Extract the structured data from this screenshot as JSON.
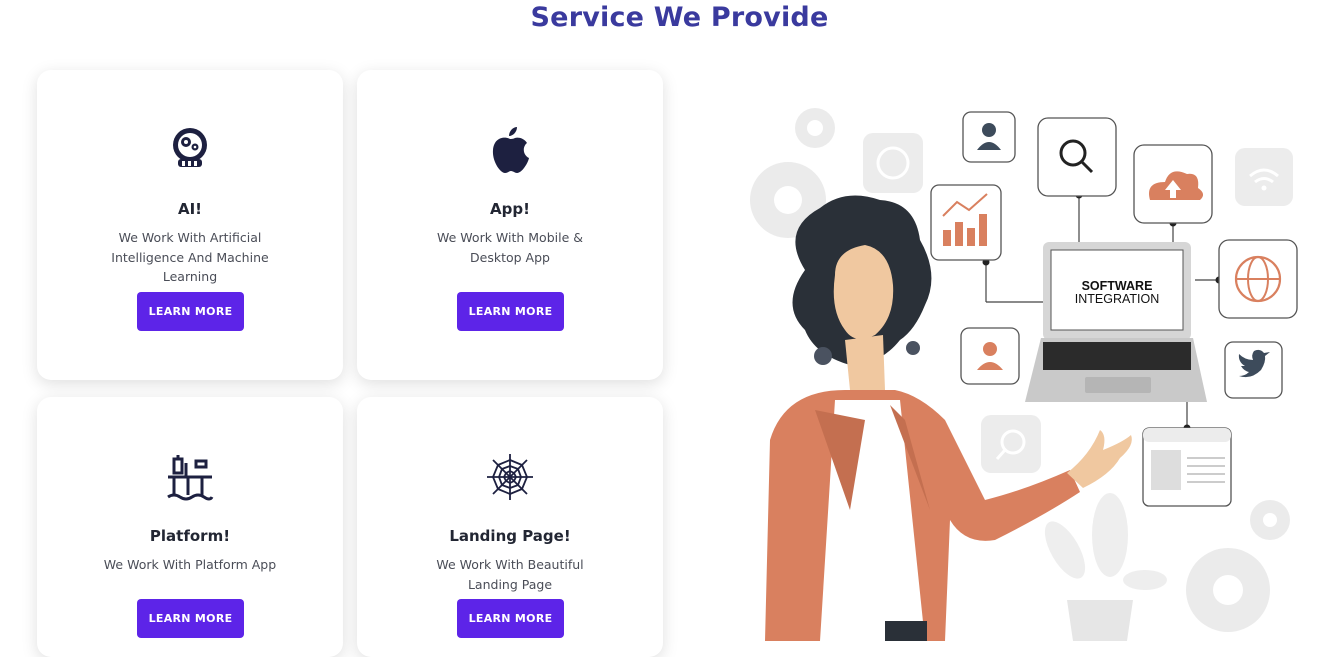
{
  "section": {
    "title": "Service We Provide"
  },
  "cards": [
    {
      "title": "AI!",
      "description": "We Work With Artificial Intelligence And Machine Learning",
      "button": "LEARN MORE",
      "icon": "ai-robot-icon"
    },
    {
      "title": "App!",
      "description": "We Work With Mobile & Desktop App",
      "button": "LEARN MORE",
      "icon": "apple-icon"
    },
    {
      "title": "Platform!",
      "description": "We Work With Platform App",
      "button": "LEARN MORE",
      "icon": "platform-icon"
    },
    {
      "title": "Landing Page!",
      "description": "We Work With Beautiful Landing Page",
      "button": "LEARN MORE",
      "icon": "spider-web-icon"
    }
  ],
  "illustration": {
    "laptop_text_line1": "SOFTWARE",
    "laptop_text_line2": "INTEGRATION",
    "accent_color": "#d9805f",
    "brand_color": "#5d24e8",
    "title_color": "#3a3a9e"
  }
}
